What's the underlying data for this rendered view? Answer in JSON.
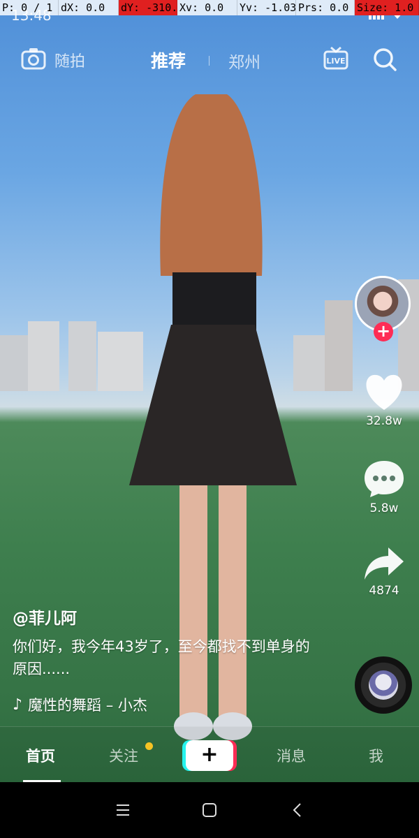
{
  "debug": {
    "p": "P: 0 / 1",
    "dx": "dX: 0.0",
    "dy": "dY: -310.0",
    "xv": "Xv: 0.0",
    "yv": "Yv: -1.032",
    "prs": "Prs: 0.0",
    "size": "Size: 1.0"
  },
  "status": {
    "time": "13:48"
  },
  "top_nav": {
    "shoot_label": "随拍",
    "recommend_label": "推荐",
    "city_label": "郑州",
    "live_icon": "live-tv-icon",
    "search_icon": "search-icon"
  },
  "actions": {
    "likes": "32.8w",
    "comments": "5.8w",
    "shares": "4874"
  },
  "post": {
    "author": "@菲儿阿",
    "caption": "你们好，我今年43岁了，至今都找不到单身的原因......",
    "music": "魔性的舞蹈 – 小杰"
  },
  "tabs": {
    "home": "首页",
    "follow": "关注",
    "add": "+",
    "messages": "消息",
    "me": "我"
  },
  "colors": {
    "accent_red": "#fe2c55",
    "accent_cyan": "#25f4ee",
    "notify_dot": "#f6c324"
  }
}
